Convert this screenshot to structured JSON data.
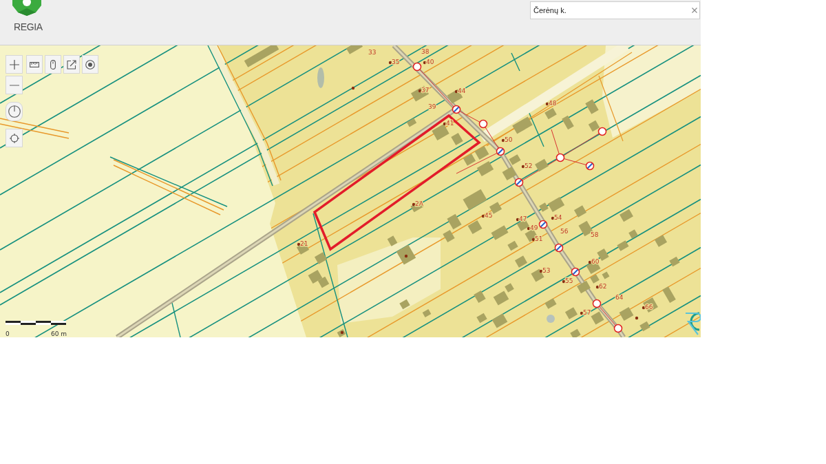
{
  "header": {
    "logo_text": "REGIA",
    "search": {
      "value": "Čerėnų k."
    }
  },
  "map": {
    "house_numbers": [
      "33",
      "38",
      "35",
      "40",
      "37",
      "44",
      "39",
      "41",
      "48",
      "50",
      "52",
      "2A",
      "45",
      "47",
      "54",
      "49",
      "56",
      "51",
      "58",
      "21",
      "60",
      "53",
      "55",
      "62",
      "64",
      "57",
      "66"
    ],
    "scale_bar": {
      "start_label": "0",
      "end_label": "60 m"
    }
  }
}
